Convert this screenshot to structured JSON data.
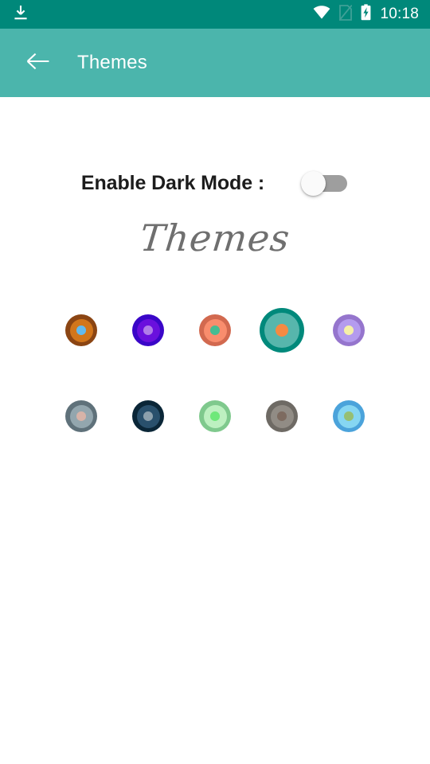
{
  "status_bar": {
    "background": "#00887A",
    "download_icon": "download-icon",
    "wifi_icon": "wifi-icon",
    "no_sim_icon": "no-sim-icon",
    "battery_charging_icon": "battery-charging-icon",
    "clock": "10:18"
  },
  "toolbar": {
    "background": "#4BB5AC",
    "back_icon": "back-arrow-icon",
    "title": "Themes"
  },
  "dark_mode": {
    "label": "Enable Dark Mode :",
    "enabled": false,
    "track_color": "#9e9e9e",
    "thumb_color": "#fafafa"
  },
  "themes_section": {
    "heading": "Themes",
    "heading_color": "#6f6f6f"
  },
  "theme_swatches": {
    "selected_index": 3,
    "rows": [
      [
        {
          "name": "theme-brown-orange",
          "outer": "#8B4513",
          "mid": "#D2761B",
          "dot": "#62BBF0",
          "selected": false
        },
        {
          "name": "theme-indigo-violet",
          "outer": "#3A06C8",
          "mid": "#6A10DD",
          "dot": "#B07DE8",
          "selected": false
        },
        {
          "name": "theme-salmon-green",
          "outer": "#D2694F",
          "mid": "#F98D6D",
          "dot": "#46BC92",
          "selected": false
        },
        {
          "name": "theme-teal-orange",
          "outer": "#00897B",
          "mid": "#57B6AC",
          "dot": "#F58A42",
          "selected": true
        },
        {
          "name": "theme-purple-yellow",
          "outer": "#9575CD",
          "mid": "#B49BEE",
          "dot": "#F5F0A8",
          "selected": false
        }
      ],
      [
        {
          "name": "theme-slate-pink",
          "outer": "#5F717A",
          "mid": "#93A6AE",
          "dot": "#D7B3A8",
          "selected": false
        },
        {
          "name": "theme-navy-gray",
          "outer": "#0A2637",
          "mid": "#29506C",
          "dot": "#8CA0AC",
          "selected": false
        },
        {
          "name": "theme-mint-green",
          "outer": "#7FC98D",
          "mid": "#BDF0C0",
          "dot": "#6EE87A",
          "selected": false
        },
        {
          "name": "theme-gray-brown",
          "outer": "#6E6A64",
          "mid": "#918C85",
          "dot": "#7D6B60",
          "selected": false
        },
        {
          "name": "theme-sky-olive",
          "outer": "#4BA3DB",
          "mid": "#86D6F2",
          "dot": "#96BF73",
          "selected": false
        }
      ]
    ]
  }
}
